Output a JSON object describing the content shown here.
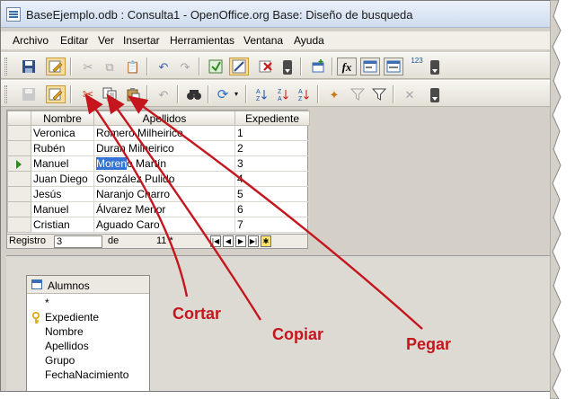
{
  "window": {
    "title": "BaseEjemplo.odb : Consulta1 - OpenOffice.org Base: Diseño de busqueda"
  },
  "menu": [
    "Archivo",
    "Editar",
    "Ver",
    "Insertar",
    "Herramientas",
    "Ventana",
    "Ayuda"
  ],
  "toolbar1": {
    "icons": [
      "save-icon",
      "edit-mode-icon",
      "cut-icon",
      "copy-icon",
      "paste-icon",
      "undo-icon",
      "redo-icon",
      "run-query-icon",
      "design-view-icon",
      "clear-query-icon",
      "add-table-icon",
      "functions-icon",
      "table-name-icon",
      "alias-icon",
      "distinct-values-icon"
    ],
    "functions_label": "fx",
    "distinct_label": "123"
  },
  "toolbar2": {
    "icons": [
      "save-record-icon",
      "edit-data-icon",
      "cut-icon",
      "copy-icon",
      "paste-icon",
      "undo-record-icon",
      "find-record-icon",
      "refresh-icon",
      "sort-ascending-icon",
      "sort-descending-icon",
      "sort-icon",
      "autofilter-icon",
      "default-filter-icon",
      "apply-filter-icon",
      "remove-filter-icon"
    ]
  },
  "grid": {
    "columns": [
      "Nombre",
      "Apellidos",
      "Expediente"
    ],
    "rows": [
      [
        "Veronica",
        "Romero Milheirico",
        "1"
      ],
      [
        "Rubén",
        "Duran Milheirico",
        "2"
      ],
      [
        "Manuel",
        "Moreno Martín",
        "3"
      ],
      [
        "Juan Diego",
        "González Pulido",
        "4"
      ],
      [
        "Jesús",
        "Naranjo Charro",
        "5"
      ],
      [
        "Manuel",
        "Álvarez Menor",
        "6"
      ],
      [
        "Cristian",
        "Aguado Caro",
        "7"
      ]
    ],
    "current_row": 2,
    "selected_text": "Moren"
  },
  "navigation": {
    "record_label": "Registro",
    "record_value": "3",
    "of_label": "de",
    "count": "11 *"
  },
  "table_window": {
    "name": "Alumnos",
    "fields": [
      "*",
      "Expediente",
      "Nombre",
      "Apellidos",
      "Grupo",
      "FechaNacimiento"
    ]
  },
  "annotations": {
    "cut": "Cortar",
    "copy": "Copiar",
    "paste": "Pegar",
    "color": "#c5161d"
  }
}
